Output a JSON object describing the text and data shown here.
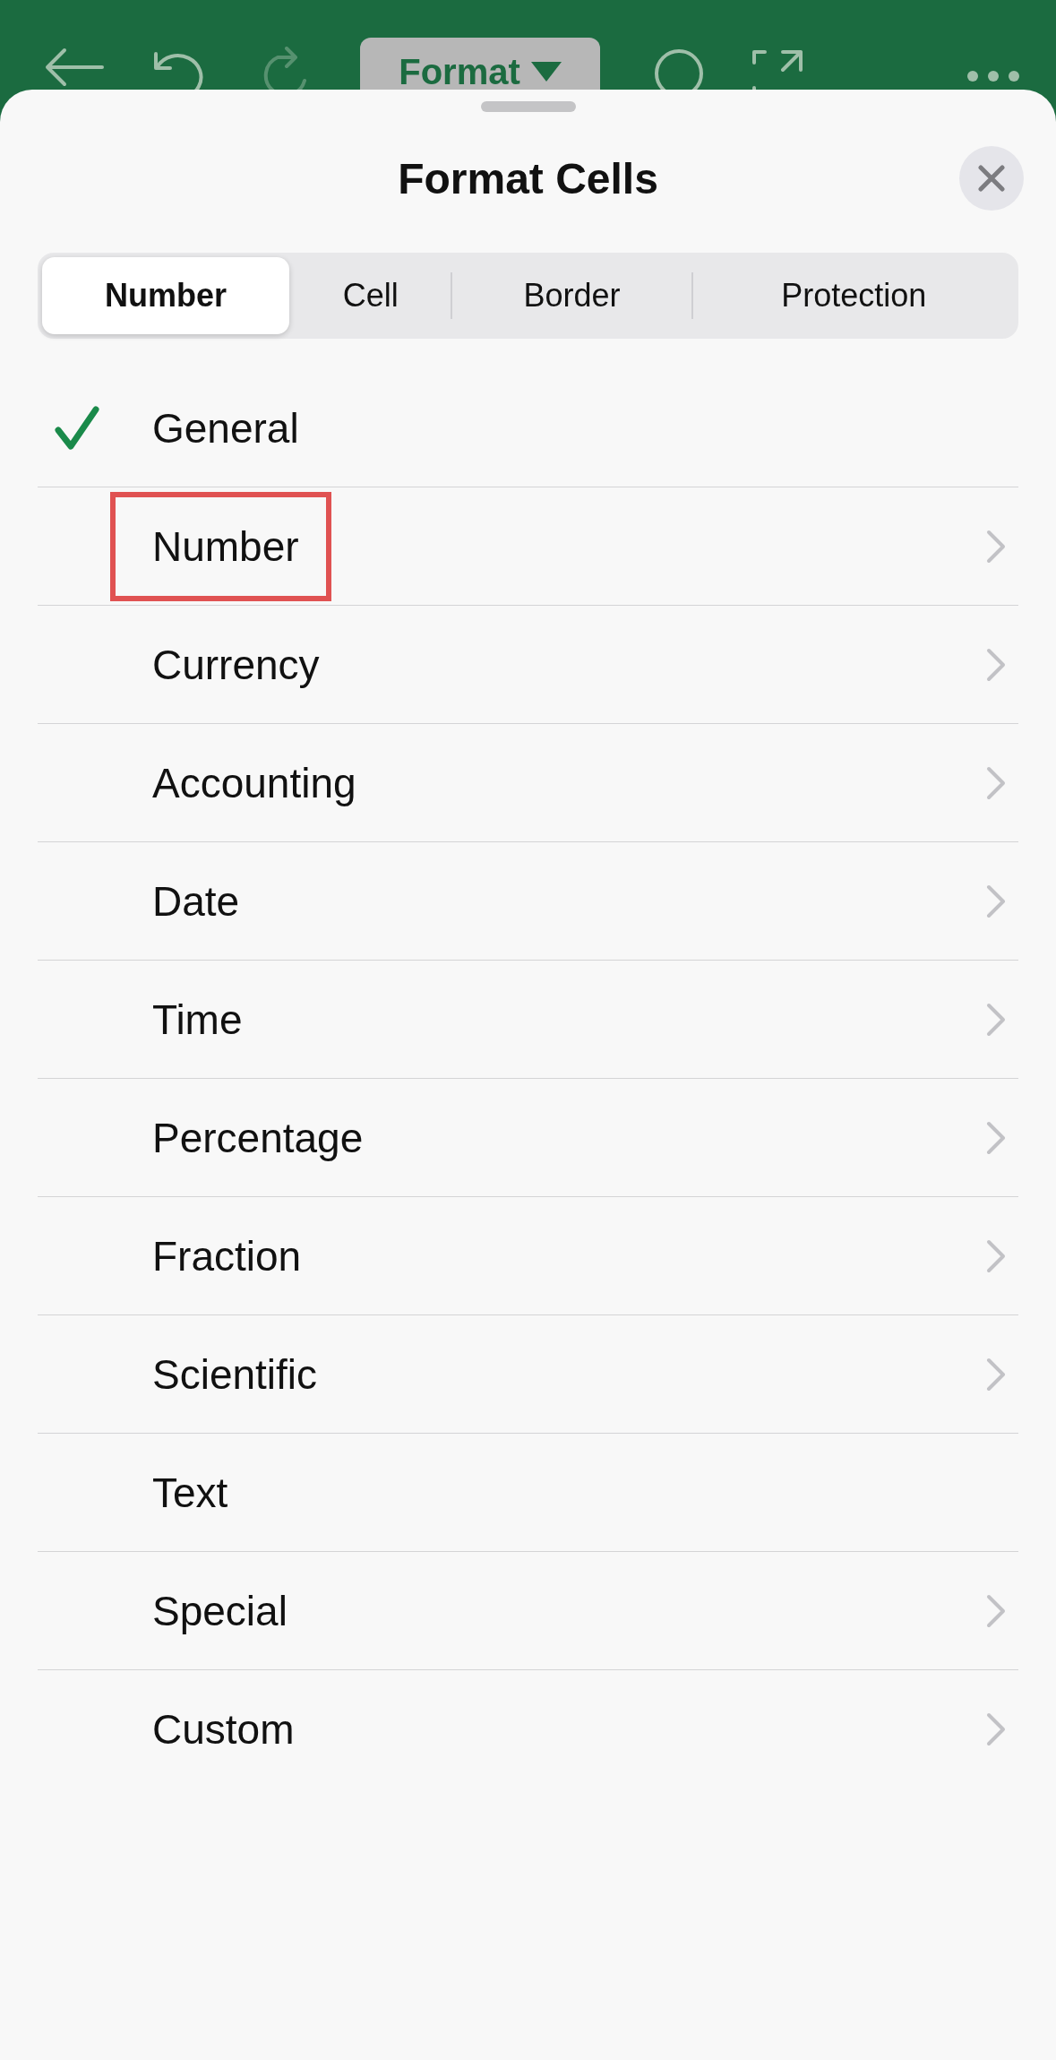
{
  "toolbar": {
    "format_button": {
      "label": "Format"
    },
    "redo_disabled": true
  },
  "sheet": {
    "title": "Format Cells",
    "tabs": [
      {
        "label": "Number",
        "selected": true
      },
      {
        "label": "Cell",
        "selected": false
      },
      {
        "label": "Border",
        "selected": false
      },
      {
        "label": "Protection",
        "selected": false
      }
    ],
    "items": [
      {
        "label": "General",
        "checked": true,
        "chevron": false,
        "highlighted": false
      },
      {
        "label": "Number",
        "checked": false,
        "chevron": true,
        "highlighted": true
      },
      {
        "label": "Currency",
        "checked": false,
        "chevron": true,
        "highlighted": false
      },
      {
        "label": "Accounting",
        "checked": false,
        "chevron": true,
        "highlighted": false
      },
      {
        "label": "Date",
        "checked": false,
        "chevron": true,
        "highlighted": false
      },
      {
        "label": "Time",
        "checked": false,
        "chevron": true,
        "highlighted": false
      },
      {
        "label": "Percentage",
        "checked": false,
        "chevron": true,
        "highlighted": false
      },
      {
        "label": "Fraction",
        "checked": false,
        "chevron": true,
        "highlighted": false
      },
      {
        "label": "Scientific",
        "checked": false,
        "chevron": true,
        "highlighted": false
      },
      {
        "label": "Text",
        "checked": false,
        "chevron": false,
        "highlighted": false
      },
      {
        "label": "Special",
        "checked": false,
        "chevron": true,
        "highlighted": false
      },
      {
        "label": "Custom",
        "checked": false,
        "chevron": true,
        "highlighted": false
      }
    ]
  }
}
